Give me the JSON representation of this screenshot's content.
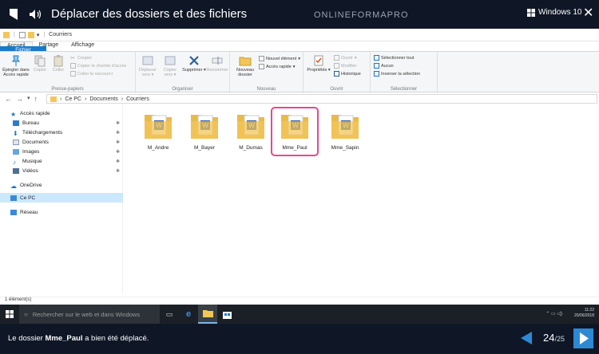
{
  "header": {
    "title": "Déplacer des dossiers et des fichiers",
    "brand": "ONLINEFORMAPRO",
    "windows_label": "Windows 10"
  },
  "explorer": {
    "qa_title": "Courriers",
    "tabs": [
      "Fichier",
      "Accueil",
      "Partage",
      "Affichage"
    ],
    "ribbon": {
      "groups": {
        "clipboard": "Presse-papiers",
        "organize": "Organiser",
        "new": "Nouveau",
        "open": "Ouvrir",
        "select": "Sélectionner"
      },
      "pin_quick": "Épingler dans Accès rapide",
      "copy": "Copier",
      "paste": "Coller",
      "cut": "Couper",
      "copy_path": "Copier le chemin d'accès",
      "paste_shortcut": "Coller le raccourci",
      "move_to": "Déplacer vers",
      "copy_to": "Copier vers",
      "delete": "Supprimer",
      "rename": "Renommer",
      "new_folder": "Nouveau dossier",
      "new_item": "Nouvel élément",
      "easy_access": "Accès rapide",
      "properties": "Propriétés",
      "open_item": "Ouvrir",
      "edit": "Modifier",
      "history": "Historique",
      "select_all": "Sélectionner tout",
      "select_none": "Aucun",
      "invert_selection": "Inverser la sélection"
    },
    "address": [
      "Ce PC",
      "Documents",
      "Courriers"
    ],
    "nav": [
      {
        "label": "Accès rapide",
        "pinned": false
      },
      {
        "label": "Bureau",
        "pinned": true
      },
      {
        "label": "Téléchargements",
        "pinned": true
      },
      {
        "label": "Documents",
        "pinned": true
      },
      {
        "label": "Images",
        "pinned": true
      },
      {
        "label": "Musique",
        "pinned": true
      },
      {
        "label": "Vidéos",
        "pinned": true
      },
      {
        "label": "OneDrive",
        "pinned": false
      },
      {
        "label": "Ce PC",
        "pinned": false
      },
      {
        "label": "Réseau",
        "pinned": false
      }
    ],
    "files": [
      "M_Andre",
      "M_Bayer",
      "M_Dumas",
      "Mme_Paul",
      "Mme_Sapin"
    ],
    "highlighted_file": "Mme_Paul",
    "status": "1 élément(s)"
  },
  "taskbar": {
    "search_placeholder": "Rechercher sur le web et dans Windows",
    "time": "11:22",
    "date": "20/06/2018"
  },
  "caption": {
    "prefix": "Le dossier",
    "bold": "Mme_Paul",
    "suffix": "a bien été déplacé.",
    "page_current": "24",
    "page_total": "/25"
  },
  "colors": {
    "highlight": "#e8488a",
    "accent": "#2c8ad4",
    "folder": "#f3c65a"
  }
}
